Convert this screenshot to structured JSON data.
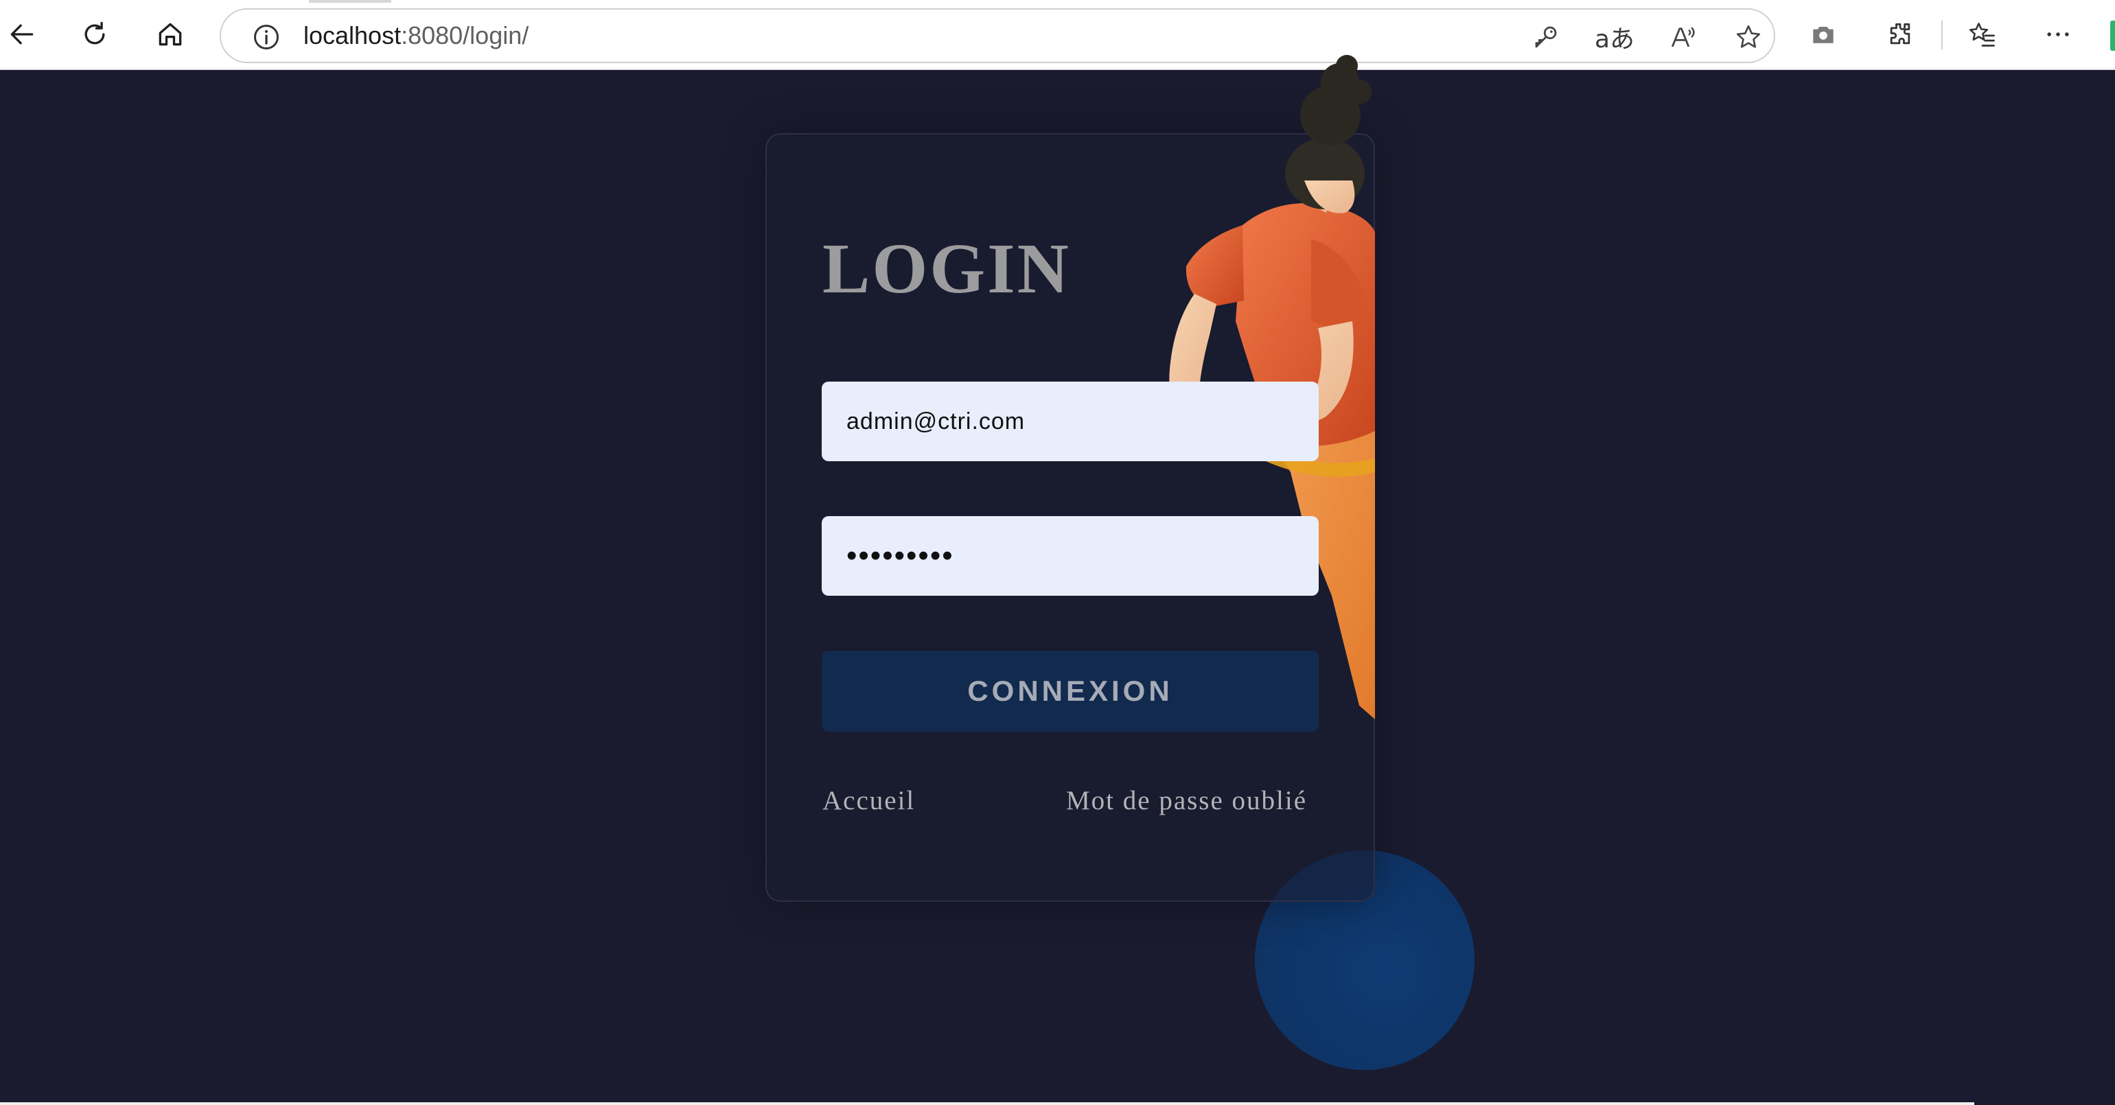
{
  "browser": {
    "url_host": "localhost",
    "url_rest": ":8080/login/",
    "omnibox_icons": [
      "key-icon",
      "translate-icon",
      "read-aloud-icon",
      "favorite-star-icon"
    ],
    "toolbar_icons": [
      "back-icon",
      "refresh-icon",
      "home-icon",
      "screenshot-icon",
      "extensions-icon",
      "favorites-icon",
      "more-icon"
    ],
    "translate_glyph": "aあ",
    "read_aloud_glyph": "A⁾",
    "more_glyph": "···"
  },
  "login": {
    "title": "LOGIN",
    "email_value": "admin@ctri.com",
    "password_value": "•••••••••",
    "submit_label": "CONNEXION",
    "home_link": "Accueil",
    "forgot_link": "Mot de passe oublié"
  },
  "colors": {
    "page_background": "#1a1b2f",
    "input_background": "#e8eefb",
    "button_background": "#132a4f",
    "accent_circle": "#0f3b73",
    "illustration_shirt": "#e3592f"
  }
}
